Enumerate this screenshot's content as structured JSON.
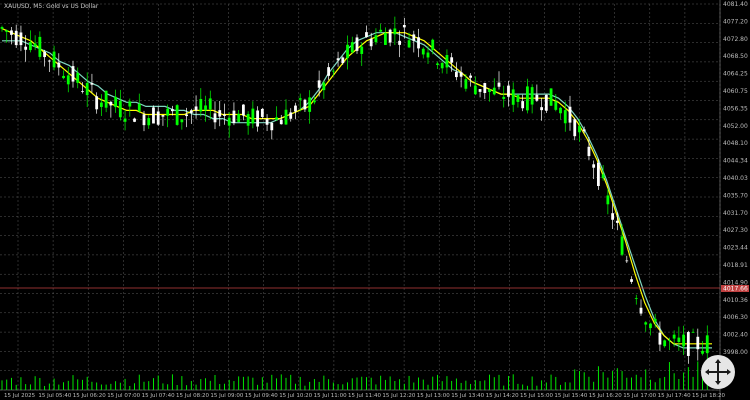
{
  "window": {
    "title": "XAUUSD, M5:  Gold vs US Dollar"
  },
  "colors": {
    "background": "#000000",
    "grid": "#5a5a5a",
    "candle_up": "#00ff00",
    "candle_down": "#ffffff",
    "ma_fast": "#ffff00",
    "ma_slow": "#7fd8c0",
    "bid_line": "#c04040",
    "bid_label_bg": "#c04040"
  },
  "price_axis": {
    "labels": [
      "4081.40",
      "4077.20",
      "4072.80",
      "4068.50",
      "4064.25",
      "4060.75",
      "4056.35",
      "4052.00",
      "4048.10",
      "4044.34",
      "4040.03",
      "4035.70",
      "4031.70",
      "4027.30",
      "4023.44",
      "4018.91",
      "4014.90",
      "4010.36",
      "4006.30",
      "4002.40",
      "3998.00"
    ],
    "bid_label": "4017.66"
  },
  "time_axis": {
    "labels": [
      "15 Jul 2025",
      "15 Jul 05:40",
      "15 Jul 06:20",
      "15 Jul 07:00",
      "15 Jul 07:40",
      "15 Jul 08:20",
      "15 Jul 09:00",
      "15 Jul 09:40",
      "15 Jul 10:20",
      "15 Jul 11:00",
      "15 Jul 11:40",
      "15 Jul 12:20",
      "15 Jul 13:00",
      "15 Jul 13:40",
      "15 Jul 14:20",
      "15 Jul 15:00",
      "15 Jul 15:40",
      "15 Jul 16:20",
      "15 Jul 17:00",
      "15 Jul 17:40",
      "15 Jul 18:20"
    ]
  },
  "chart_data": {
    "type": "candlestick",
    "symbol": "XAUUSD",
    "timeframe": "M5",
    "ylim": [
      3998.0,
      4083.0
    ],
    "moving_averages": [
      {
        "values": [
          4077,
          4076,
          4075,
          4074,
          4072,
          4070,
          4068,
          4066,
          4064,
          4062,
          4060,
          4059,
          4058,
          4057,
          4057,
          4056,
          4056,
          4056,
          4056,
          4056,
          4057,
          4057,
          4057,
          4056,
          4056,
          4056,
          4055,
          4055,
          4055,
          4055,
          4056,
          4057,
          4058,
          4061,
          4064,
          4067,
          4070,
          4072,
          4074,
          4075,
          4076,
          4076,
          4076,
          4075,
          4074,
          4072,
          4070,
          4068,
          4066,
          4064,
          4063,
          4062,
          4061,
          4061,
          4060,
          4060,
          4060,
          4060,
          4059,
          4057,
          4054,
          4050,
          4045,
          4039,
          4032,
          4025,
          4017,
          4010,
          4005,
          4002,
          4000,
          4000,
          4000,
          4000,
          4000
        ]
      },
      {
        "values": [
          4074,
          4074,
          4074,
          4073,
          4072,
          4071,
          4069,
          4068,
          4066,
          4064,
          4063,
          4061,
          4060,
          4059,
          4059,
          4058,
          4058,
          4058,
          4057,
          4057,
          4056,
          4056,
          4055,
          4055,
          4054,
          4054,
          4054,
          4054,
          4054,
          4055,
          4056,
          4057,
          4059,
          4062,
          4066,
          4069,
          4072,
          4074,
          4075,
          4076,
          4076,
          4076,
          4075,
          4074,
          4073,
          4071,
          4069,
          4067,
          4066,
          4064,
          4063,
          4062,
          4061,
          4061,
          4061,
          4061,
          4061,
          4061,
          4060,
          4058,
          4055,
          4051,
          4046,
          4040,
          4033,
          4026,
          4019,
          4012,
          4006,
          4002,
          4000,
          3999,
          3999,
          3999,
          3999
        ]
      }
    ],
    "volume_visible": true
  }
}
